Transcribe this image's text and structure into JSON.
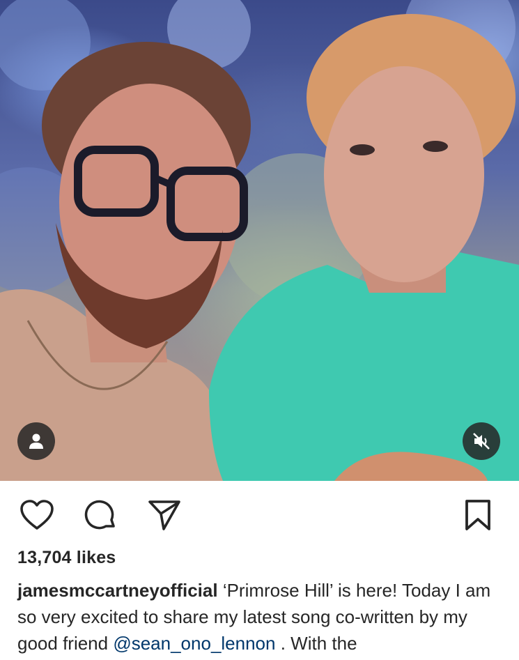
{
  "post": {
    "media_alt": "Photo of two men posing together outdoors",
    "icons": {
      "user_tag": "user-tag-icon",
      "mute": "mute-icon",
      "like": "heart-icon",
      "comment": "comment-bubble-icon",
      "share": "paper-plane-icon",
      "save": "bookmark-icon"
    },
    "likes_text": "13,704 likes",
    "caption": {
      "username": "jamesmccartneyofficial",
      "text_before_mention": " ‘Primrose Hill’ is here! Today I am so very excited to share my latest song co-written by my good friend ",
      "mention": "@sean_ono_lennon",
      "text_after_mention": " . With the"
    }
  },
  "colors": {
    "text": "#262626",
    "mention": "#00376b",
    "overlay_button_bg": "#262626"
  }
}
